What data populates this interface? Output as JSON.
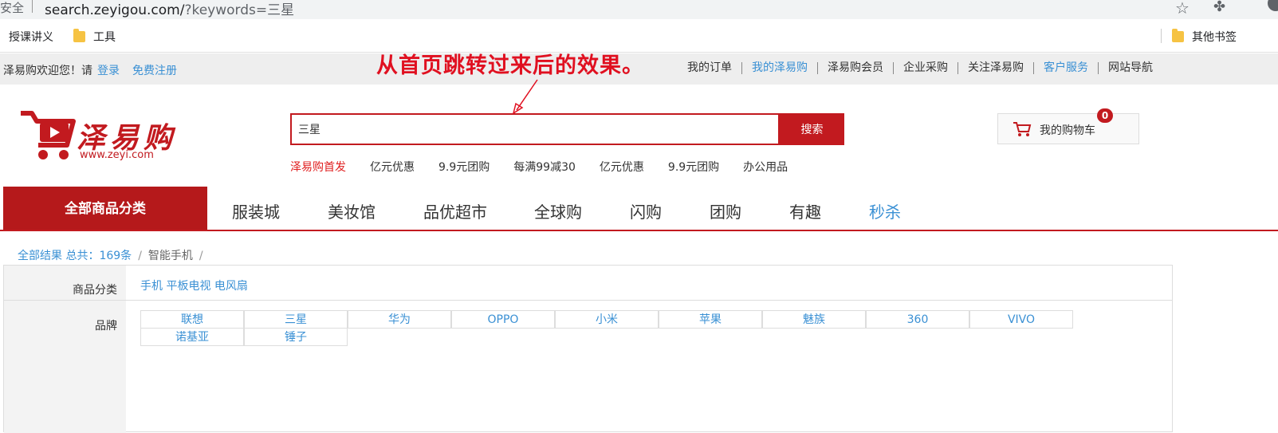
{
  "browser": {
    "security_label": "安全",
    "url_host": "search.zeyigou.com/",
    "url_path": "?keywords=三星",
    "bookmarks": [
      "授课讲义",
      "工具"
    ],
    "other_bookmarks": "其他书签"
  },
  "topbar": {
    "welcome": "泽易购欢迎您！请",
    "login": "登录",
    "register": "免费注册",
    "annotation": "从首页跳转过来后的效果。",
    "links": [
      {
        "label": "我的订单",
        "active": false
      },
      {
        "label": "我的泽易购",
        "active": true
      },
      {
        "label": "泽易购会员",
        "active": false
      },
      {
        "label": "企业采购",
        "active": false
      },
      {
        "label": "关注泽易购",
        "active": false
      },
      {
        "label": "客户服务",
        "active": true
      },
      {
        "label": "网站导航",
        "active": false
      }
    ]
  },
  "header": {
    "logo_text": "泽易购",
    "logo_url": "www.zeyi.com",
    "search_value": "三星",
    "search_button": "搜索",
    "hotwords": [
      "泽易购首发",
      "亿元优惠",
      "9.9元团购",
      "每满99减30",
      "亿元优惠",
      "9.9元团购",
      "办公用品"
    ],
    "cart_label": "我的购物车",
    "cart_count": "0"
  },
  "nav": {
    "all_categories": "全部商品分类",
    "items": [
      "服装城",
      "美妆馆",
      "品优超市",
      "全球购",
      "闪购",
      "团购",
      "有趣",
      "秒杀"
    ]
  },
  "breadcrumb": {
    "all_results": "全部结果",
    "total": "总共：169条",
    "current": "智能手机"
  },
  "filters": {
    "category_label": "商品分类",
    "categories": [
      "手机",
      "平板电视",
      "电风扇"
    ],
    "brand_label": "品牌",
    "brands": [
      "联想",
      "三星",
      "华为",
      "OPPO",
      "小米",
      "苹果",
      "魅族",
      "360",
      "VIVO",
      "诺基亚",
      "锤子"
    ]
  },
  "colors": {
    "brand_red": "#c21a1f",
    "link_blue": "#3a90d4"
  }
}
